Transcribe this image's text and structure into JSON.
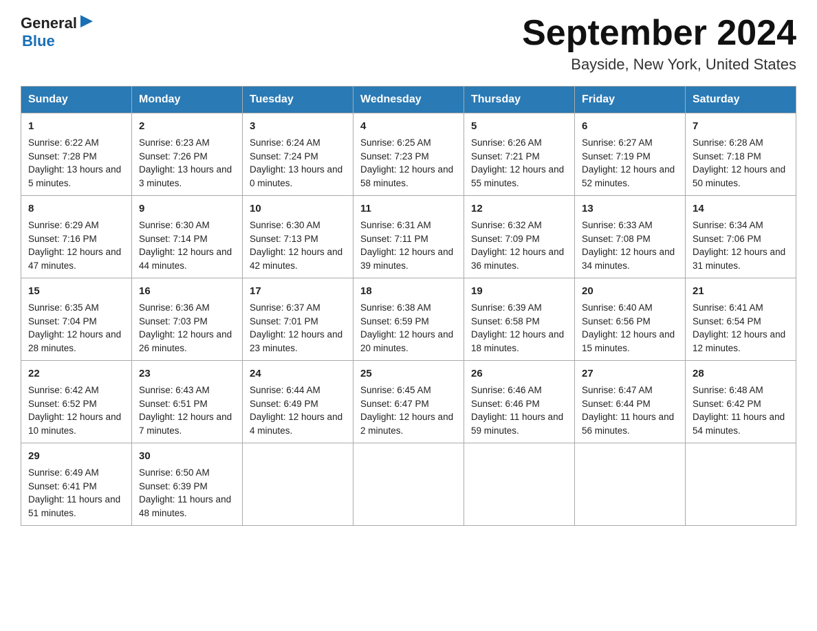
{
  "header": {
    "logo_general": "General",
    "logo_blue": "Blue",
    "month_title": "September 2024",
    "location": "Bayside, New York, United States"
  },
  "days_of_week": [
    "Sunday",
    "Monday",
    "Tuesday",
    "Wednesday",
    "Thursday",
    "Friday",
    "Saturday"
  ],
  "weeks": [
    [
      {
        "day": "1",
        "sunrise": "6:22 AM",
        "sunset": "7:28 PM",
        "daylight": "13 hours and 5 minutes."
      },
      {
        "day": "2",
        "sunrise": "6:23 AM",
        "sunset": "7:26 PM",
        "daylight": "13 hours and 3 minutes."
      },
      {
        "day": "3",
        "sunrise": "6:24 AM",
        "sunset": "7:24 PM",
        "daylight": "13 hours and 0 minutes."
      },
      {
        "day": "4",
        "sunrise": "6:25 AM",
        "sunset": "7:23 PM",
        "daylight": "12 hours and 58 minutes."
      },
      {
        "day": "5",
        "sunrise": "6:26 AM",
        "sunset": "7:21 PM",
        "daylight": "12 hours and 55 minutes."
      },
      {
        "day": "6",
        "sunrise": "6:27 AM",
        "sunset": "7:19 PM",
        "daylight": "12 hours and 52 minutes."
      },
      {
        "day": "7",
        "sunrise": "6:28 AM",
        "sunset": "7:18 PM",
        "daylight": "12 hours and 50 minutes."
      }
    ],
    [
      {
        "day": "8",
        "sunrise": "6:29 AM",
        "sunset": "7:16 PM",
        "daylight": "12 hours and 47 minutes."
      },
      {
        "day": "9",
        "sunrise": "6:30 AM",
        "sunset": "7:14 PM",
        "daylight": "12 hours and 44 minutes."
      },
      {
        "day": "10",
        "sunrise": "6:30 AM",
        "sunset": "7:13 PM",
        "daylight": "12 hours and 42 minutes."
      },
      {
        "day": "11",
        "sunrise": "6:31 AM",
        "sunset": "7:11 PM",
        "daylight": "12 hours and 39 minutes."
      },
      {
        "day": "12",
        "sunrise": "6:32 AM",
        "sunset": "7:09 PM",
        "daylight": "12 hours and 36 minutes."
      },
      {
        "day": "13",
        "sunrise": "6:33 AM",
        "sunset": "7:08 PM",
        "daylight": "12 hours and 34 minutes."
      },
      {
        "day": "14",
        "sunrise": "6:34 AM",
        "sunset": "7:06 PM",
        "daylight": "12 hours and 31 minutes."
      }
    ],
    [
      {
        "day": "15",
        "sunrise": "6:35 AM",
        "sunset": "7:04 PM",
        "daylight": "12 hours and 28 minutes."
      },
      {
        "day": "16",
        "sunrise": "6:36 AM",
        "sunset": "7:03 PM",
        "daylight": "12 hours and 26 minutes."
      },
      {
        "day": "17",
        "sunrise": "6:37 AM",
        "sunset": "7:01 PM",
        "daylight": "12 hours and 23 minutes."
      },
      {
        "day": "18",
        "sunrise": "6:38 AM",
        "sunset": "6:59 PM",
        "daylight": "12 hours and 20 minutes."
      },
      {
        "day": "19",
        "sunrise": "6:39 AM",
        "sunset": "6:58 PM",
        "daylight": "12 hours and 18 minutes."
      },
      {
        "day": "20",
        "sunrise": "6:40 AM",
        "sunset": "6:56 PM",
        "daylight": "12 hours and 15 minutes."
      },
      {
        "day": "21",
        "sunrise": "6:41 AM",
        "sunset": "6:54 PM",
        "daylight": "12 hours and 12 minutes."
      }
    ],
    [
      {
        "day": "22",
        "sunrise": "6:42 AM",
        "sunset": "6:52 PM",
        "daylight": "12 hours and 10 minutes."
      },
      {
        "day": "23",
        "sunrise": "6:43 AM",
        "sunset": "6:51 PM",
        "daylight": "12 hours and 7 minutes."
      },
      {
        "day": "24",
        "sunrise": "6:44 AM",
        "sunset": "6:49 PM",
        "daylight": "12 hours and 4 minutes."
      },
      {
        "day": "25",
        "sunrise": "6:45 AM",
        "sunset": "6:47 PM",
        "daylight": "12 hours and 2 minutes."
      },
      {
        "day": "26",
        "sunrise": "6:46 AM",
        "sunset": "6:46 PM",
        "daylight": "11 hours and 59 minutes."
      },
      {
        "day": "27",
        "sunrise": "6:47 AM",
        "sunset": "6:44 PM",
        "daylight": "11 hours and 56 minutes."
      },
      {
        "day": "28",
        "sunrise": "6:48 AM",
        "sunset": "6:42 PM",
        "daylight": "11 hours and 54 minutes."
      }
    ],
    [
      {
        "day": "29",
        "sunrise": "6:49 AM",
        "sunset": "6:41 PM",
        "daylight": "11 hours and 51 minutes."
      },
      {
        "day": "30",
        "sunrise": "6:50 AM",
        "sunset": "6:39 PM",
        "daylight": "11 hours and 48 minutes."
      },
      null,
      null,
      null,
      null,
      null
    ]
  ],
  "labels": {
    "sunrise": "Sunrise:",
    "sunset": "Sunset:",
    "daylight": "Daylight:"
  }
}
